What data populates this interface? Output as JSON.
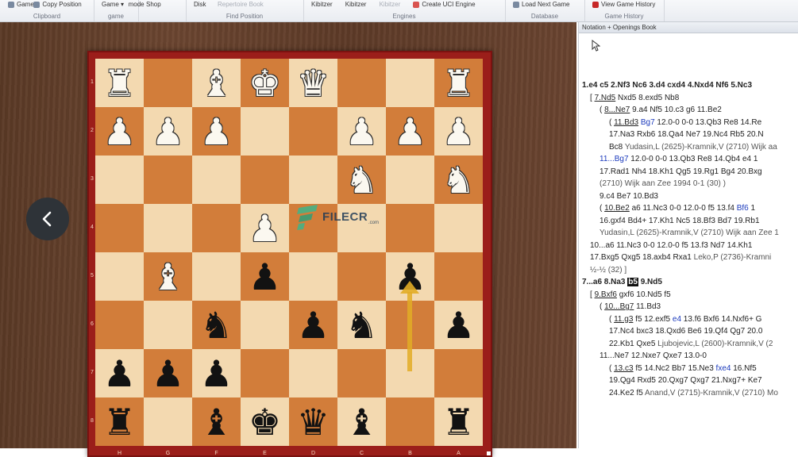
{
  "ribbon": {
    "groups": [
      {
        "caption": "Clipboard",
        "items": [
          {
            "label": "Game",
            "icon": "game-icon",
            "dim": false
          },
          {
            "label": "Copy Position",
            "icon": "copy-icon",
            "dim": false
          }
        ]
      },
      {
        "caption": "game",
        "items": [
          {
            "label": "Game ▾",
            "icon": "",
            "dim": false
          },
          {
            "label": "mode",
            "icon": "",
            "dim": false
          }
        ]
      },
      {
        "caption": "",
        "items": [
          {
            "label": "Shop",
            "icon": "",
            "dim": false
          }
        ]
      },
      {
        "caption": "Find Position",
        "items": [
          {
            "label": "Disk",
            "icon": "",
            "dim": false
          },
          {
            "label": "Repertoire Book",
            "icon": "",
            "dim": true
          }
        ]
      },
      {
        "caption": "Engines",
        "items": [
          {
            "label": "Kibitzer",
            "icon": "",
            "dim": false
          },
          {
            "label": "Kibitzer",
            "icon": "",
            "dim": false
          },
          {
            "label": "Kibitzer",
            "icon": "",
            "dim": true
          },
          {
            "label": "Create UCI Engine",
            "icon": "engine-icon",
            "dim": false
          }
        ]
      },
      {
        "caption": "Database",
        "items": [
          {
            "label": "Load Next Game",
            "icon": "load-icon",
            "dim": false
          }
        ]
      },
      {
        "caption": "Game History",
        "items": [
          {
            "label": "View Game History",
            "icon": "history-icon",
            "dim": false
          }
        ]
      }
    ]
  },
  "board": {
    "ranks": [
      "1",
      "2",
      "3",
      "4",
      "5",
      "6",
      "7",
      "8"
    ],
    "files": [
      "H",
      "G",
      "F",
      "E",
      "D",
      "C",
      "B",
      "A"
    ],
    "rows": [
      [
        {
          "p": "♜",
          "c": "w"
        },
        {
          "p": "",
          "c": ""
        },
        {
          "p": "♝",
          "c": "w"
        },
        {
          "p": "♚",
          "c": "w"
        },
        {
          "p": "♛",
          "c": "w"
        },
        {
          "p": "",
          "c": ""
        },
        {
          "p": "",
          "c": ""
        },
        {
          "p": "♜",
          "c": "w"
        }
      ],
      [
        {
          "p": "♟",
          "c": "w"
        },
        {
          "p": "♟",
          "c": "w"
        },
        {
          "p": "♟",
          "c": "w"
        },
        {
          "p": "",
          "c": ""
        },
        {
          "p": "",
          "c": ""
        },
        {
          "p": "♟",
          "c": "w"
        },
        {
          "p": "♟",
          "c": "w"
        },
        {
          "p": "♟",
          "c": "w"
        }
      ],
      [
        {
          "p": "",
          "c": ""
        },
        {
          "p": "",
          "c": ""
        },
        {
          "p": "",
          "c": ""
        },
        {
          "p": "",
          "c": ""
        },
        {
          "p": "",
          "c": ""
        },
        {
          "p": "♞",
          "c": "w"
        },
        {
          "p": "",
          "c": ""
        },
        {
          "p": "♞",
          "c": "w"
        }
      ],
      [
        {
          "p": "",
          "c": ""
        },
        {
          "p": "",
          "c": ""
        },
        {
          "p": "",
          "c": ""
        },
        {
          "p": "♟",
          "c": "w"
        },
        {
          "p": "",
          "c": ""
        },
        {
          "p": "",
          "c": ""
        },
        {
          "p": "",
          "c": ""
        },
        {
          "p": "",
          "c": ""
        }
      ],
      [
        {
          "p": "",
          "c": ""
        },
        {
          "p": "♝",
          "c": "w"
        },
        {
          "p": "",
          "c": ""
        },
        {
          "p": "♟",
          "c": "b"
        },
        {
          "p": "",
          "c": ""
        },
        {
          "p": "",
          "c": ""
        },
        {
          "p": "♟",
          "c": "b"
        },
        {
          "p": "",
          "c": ""
        }
      ],
      [
        {
          "p": "",
          "c": ""
        },
        {
          "p": "",
          "c": ""
        },
        {
          "p": "♞",
          "c": "b"
        },
        {
          "p": "",
          "c": ""
        },
        {
          "p": "♟",
          "c": "b"
        },
        {
          "p": "♞",
          "c": "b"
        },
        {
          "p": "",
          "c": ""
        },
        {
          "p": "♟",
          "c": "b"
        }
      ],
      [
        {
          "p": "♟",
          "c": "b"
        },
        {
          "p": "♟",
          "c": "b"
        },
        {
          "p": "♟",
          "c": "b"
        },
        {
          "p": "",
          "c": ""
        },
        {
          "p": "",
          "c": ""
        },
        {
          "p": "",
          "c": ""
        },
        {
          "p": "",
          "c": ""
        },
        {
          "p": "",
          "c": ""
        }
      ],
      [
        {
          "p": "♜",
          "c": "b"
        },
        {
          "p": "",
          "c": ""
        },
        {
          "p": "♝",
          "c": "b"
        },
        {
          "p": "♚",
          "c": "b"
        },
        {
          "p": "♛",
          "c": "b"
        },
        {
          "p": "♝",
          "c": "b"
        },
        {
          "p": "",
          "c": ""
        },
        {
          "p": "♜",
          "c": "b"
        }
      ]
    ],
    "light_color": "#f3d9b0",
    "dark_color": "#d27d3a",
    "frame_color": "#9b1e1a",
    "arrow_color": "#e2ac26"
  },
  "watermark": {
    "text": "FILECR",
    "sub": ".com"
  },
  "nav": {
    "back_icon": "chevron-left-icon"
  },
  "notation": {
    "title": "Notation + Openings Book",
    "lines": [
      {
        "indent": 4,
        "cls": "main-line",
        "segs": [
          {
            "t": "1.e4  c5  2.Nf3  Nc6  3.d4  cxd4  4.Nxd4  Nf6  5.Nc3",
            "s": ""
          }
        ]
      },
      {
        "indent": 14,
        "cls": "",
        "segs": [
          {
            "t": "[ ",
            "s": ""
          },
          {
            "t": "7.Nd5",
            "s": "u"
          },
          {
            "t": "  Nxd5  8.exd5  Nb8",
            "s": ""
          }
        ]
      },
      {
        "indent": 26,
        "cls": "",
        "segs": [
          {
            "t": "( ",
            "s": ""
          },
          {
            "t": "8...Ne7",
            "s": "u"
          },
          {
            "t": "  9.a4  Nf5  10.c3  g6  11.Be2",
            "s": ""
          }
        ]
      },
      {
        "indent": 38,
        "cls": "",
        "segs": [
          {
            "t": "( ",
            "s": ""
          },
          {
            "t": "11.Bd3",
            "s": "u"
          },
          {
            "t": "  ",
            "s": ""
          },
          {
            "t": "Bg7",
            "s": "blue"
          },
          {
            "t": "  12.0-0  0-0  13.Qb3  Re8  14.Re",
            "s": ""
          }
        ]
      },
      {
        "indent": 38,
        "cls": "",
        "segs": [
          {
            "t": "17.Na3  Rxb6  18.Qa4  Ne7  19.Nc4  Rb5  20.N",
            "s": ""
          }
        ]
      },
      {
        "indent": 38,
        "cls": "",
        "segs": [
          {
            "t": "Bc8  ",
            "s": ""
          },
          {
            "t": "Yudasin,L (2625)-Kramnik,V (2710) Wijk aa",
            "s": "grey"
          }
        ]
      },
      {
        "indent": 26,
        "cls": "",
        "segs": [
          {
            "t": "11...Bg7",
            "s": "blue"
          },
          {
            "t": "  12.0-0  0-0  13.Qb3  Re8  14.Qb4  e4  1",
            "s": ""
          }
        ]
      },
      {
        "indent": 26,
        "cls": "",
        "segs": [
          {
            "t": "17.Rad1  Nh4  18.Kh1  Qg5  19.Rg1  Bg4  20.Bxg",
            "s": ""
          }
        ]
      },
      {
        "indent": 26,
        "cls": "",
        "segs": [
          {
            "t": "(2710) Wijk aan Zee 1994 0-1 (30) )",
            "s": "grey"
          }
        ]
      },
      {
        "indent": 26,
        "cls": "",
        "segs": [
          {
            "t": "9.c4  Be7  10.Bd3",
            "s": ""
          }
        ]
      },
      {
        "indent": 26,
        "cls": "",
        "segs": [
          {
            "t": "( ",
            "s": ""
          },
          {
            "t": "10.Be2",
            "s": "u"
          },
          {
            "t": "  a6  11.Nc3  0-0  12.0-0  f5  13.f4  ",
            "s": ""
          },
          {
            "t": "Bf6",
            "s": "blue"
          },
          {
            "t": "  1",
            "s": ""
          }
        ]
      },
      {
        "indent": 26,
        "cls": "",
        "segs": [
          {
            "t": "16.gxf4  Bd4+  17.Kh1  Nc5  18.Bf3  Bd7  19.Rb1",
            "s": ""
          }
        ]
      },
      {
        "indent": 26,
        "cls": "",
        "segs": [
          {
            "t": "Yudasin,L (2625)-Kramnik,V (2710) Wijk aan Zee 1",
            "s": "grey"
          }
        ]
      },
      {
        "indent": 14,
        "cls": "",
        "segs": [
          {
            "t": "10...a6  11.Nc3  0-0  12.0-0  f5  13.f3  Nd7  14.Kh1",
            "s": ""
          }
        ]
      },
      {
        "indent": 14,
        "cls": "",
        "segs": [
          {
            "t": "17.Bxg5  Qxg5  18.axb4  Rxa1  ",
            "s": ""
          },
          {
            "t": "Leko,P (2736)-Kramni",
            "s": "grey"
          }
        ]
      },
      {
        "indent": 14,
        "cls": "",
        "segs": [
          {
            "t": "½-½ (32) ]",
            "s": "grey"
          }
        ]
      },
      {
        "indent": 4,
        "cls": "main-line",
        "segs": [
          {
            "t": "7...a6  8.Na3  ",
            "s": ""
          },
          {
            "t": "b5",
            "s": "hl"
          },
          {
            "t": "  9.Nd5",
            "s": ""
          }
        ]
      },
      {
        "indent": 14,
        "cls": "",
        "segs": [
          {
            "t": "[ ",
            "s": ""
          },
          {
            "t": "9.Bxf6",
            "s": "u"
          },
          {
            "t": "  gxf6  10.Nd5  f5",
            "s": ""
          }
        ]
      },
      {
        "indent": 26,
        "cls": "",
        "segs": [
          {
            "t": "( ",
            "s": ""
          },
          {
            "t": "10...Bg7",
            "s": "u"
          },
          {
            "t": "  11.Bd3",
            "s": ""
          }
        ]
      },
      {
        "indent": 38,
        "cls": "",
        "segs": [
          {
            "t": "( ",
            "s": ""
          },
          {
            "t": "11.g3",
            "s": "u"
          },
          {
            "t": "  f5  12.exf5  ",
            "s": ""
          },
          {
            "t": "e4",
            "s": "blue"
          },
          {
            "t": "  13.f6  Bxf6  14.Nxf6+  G",
            "s": ""
          }
        ]
      },
      {
        "indent": 38,
        "cls": "",
        "segs": [
          {
            "t": "17.Nc4  bxc3  18.Qxd6  Be6  19.Qf4  Qg7  20.0",
            "s": ""
          }
        ]
      },
      {
        "indent": 38,
        "cls": "",
        "segs": [
          {
            "t": "22.Kb1  Qxe5  ",
            "s": ""
          },
          {
            "t": "Ljubojevic,L (2600)-Kramnik,V (2",
            "s": "grey"
          }
        ]
      },
      {
        "indent": 26,
        "cls": "",
        "segs": [
          {
            "t": "11...Ne7  12.Nxe7  Qxe7  13.0-0",
            "s": ""
          }
        ]
      },
      {
        "indent": 38,
        "cls": "",
        "segs": [
          {
            "t": "( ",
            "s": ""
          },
          {
            "t": "13.c3",
            "s": "u"
          },
          {
            "t": "  f5  14.Nc2  Bb7  15.Ne3  ",
            "s": ""
          },
          {
            "t": "fxe4",
            "s": "blue"
          },
          {
            "t": "  16.Nf5",
            "s": ""
          }
        ]
      },
      {
        "indent": 38,
        "cls": "",
        "segs": [
          {
            "t": "19.Qg4  Rxd5  20.Qxg7  Qxg7  21.Nxg7+  Ke7",
            "s": ""
          }
        ]
      },
      {
        "indent": 38,
        "cls": "",
        "segs": [
          {
            "t": "24.Ke2  f5  ",
            "s": ""
          },
          {
            "t": "Anand,V (2715)-Kramnik,V (2710) Mo",
            "s": "grey"
          }
        ]
      }
    ]
  }
}
